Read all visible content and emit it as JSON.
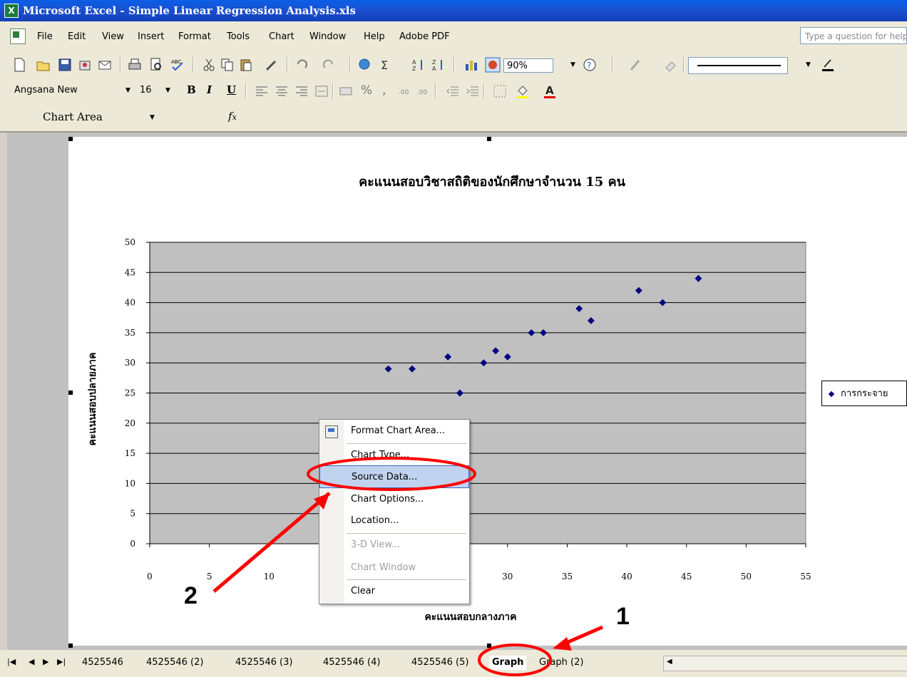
{
  "window": {
    "title": "Microsoft Excel - Simple Linear Regression Analysis.xls",
    "app_icon": "excel-icon"
  },
  "menu": {
    "items": [
      "File",
      "Edit",
      "View",
      "Insert",
      "Format",
      "Tools",
      "Chart",
      "Window",
      "Help",
      "Adobe PDF"
    ],
    "help_placeholder": "Type a question for help"
  },
  "toolbar": {
    "zoom": "90%"
  },
  "format_toolbar": {
    "font": "Angsana New",
    "size": "16",
    "bold": "B",
    "italic": "I",
    "underline": "U",
    "percent": "%",
    "comma": ","
  },
  "formula_bar": {
    "name_box": "Chart Area",
    "fx": "fx"
  },
  "chart_data": {
    "type": "scatter",
    "title": "คะแนนสอบวิชาสถิติของนักศึกษาจำนวน 15 คน",
    "xlabel": "คะแนนสอบกลางภาค",
    "ylabel": "คะแนนสอบปลายภาค",
    "xlim": [
      0,
      55
    ],
    "ylim": [
      0,
      50
    ],
    "x_ticks": [
      "0",
      "5",
      "10",
      "15",
      "20",
      "25",
      "30",
      "35",
      "40",
      "45",
      "50",
      "55"
    ],
    "y_ticks": [
      "0",
      "5",
      "10",
      "15",
      "20",
      "25",
      "30",
      "35",
      "40",
      "45",
      "50"
    ],
    "series": [
      {
        "name": "การกระจาย",
        "color": "#000080",
        "points": [
          [
            20,
            29
          ],
          [
            22,
            29
          ],
          [
            25,
            31
          ],
          [
            26,
            25
          ],
          [
            28,
            30
          ],
          [
            29,
            32
          ],
          [
            30,
            31
          ],
          [
            32,
            35
          ],
          [
            33,
            35
          ],
          [
            36,
            39
          ],
          [
            37,
            37
          ],
          [
            41,
            42
          ],
          [
            43,
            40
          ],
          [
            46,
            44
          ]
        ]
      }
    ],
    "grid": "horizontal",
    "plot_background": "#c0c0c0",
    "legend_position": "right"
  },
  "context_menu": {
    "items": [
      {
        "label": "Format Chart Area...",
        "enabled": true,
        "icon": "format-chart-icon"
      },
      {
        "label": "Chart Type...",
        "enabled": true
      },
      {
        "label": "Source Data...",
        "enabled": true,
        "highlighted": true
      },
      {
        "label": "Chart Options...",
        "enabled": true
      },
      {
        "label": "Location...",
        "enabled": true
      },
      {
        "label": "3-D View...",
        "enabled": false
      },
      {
        "label": "Chart Window",
        "enabled": false
      },
      {
        "label": "Clear",
        "enabled": true
      }
    ]
  },
  "sheet_tabs": [
    "4525546",
    "4525546 (2)",
    "4525546 (3)",
    "4525546 (4)",
    "4525546 (5)",
    "Graph",
    "Graph (2)"
  ],
  "active_tab": "Graph",
  "annotations": {
    "step1": "1",
    "step2": "2",
    "color": "#ff0000"
  }
}
